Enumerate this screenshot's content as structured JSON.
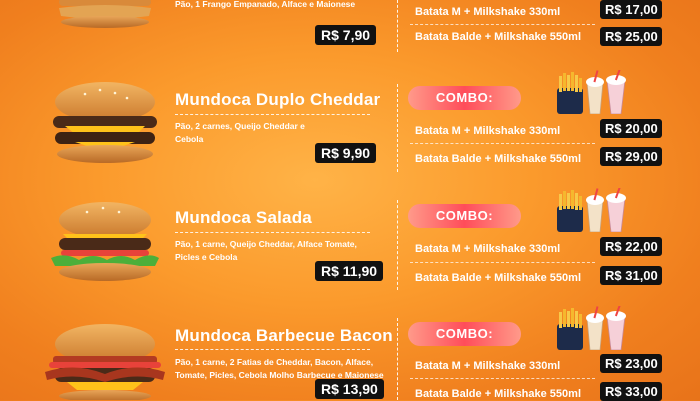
{
  "items": [
    {
      "name": "",
      "desc": "Pão, 1 Frango Empanado, Alface e Maionese",
      "price": "R$ 7,90",
      "combo_label": "",
      "combos": [
        {
          "label": "Batata M + Milkshake 330ml",
          "price": "R$ 17,00"
        },
        {
          "label": "Batata Balde + Milkshake 550ml",
          "price": "R$ 25,00"
        }
      ]
    },
    {
      "name": "Mundoca Duplo Cheddar",
      "desc": "Pão, 2 carnes, Queijo Cheddar e Cebola",
      "price": "R$ 9,90",
      "combo_label": "COMBO:",
      "combos": [
        {
          "label": "Batata M + Milkshake 330ml",
          "price": "R$ 20,00"
        },
        {
          "label": "Batata Balde + Milkshake 550ml",
          "price": "R$ 29,00"
        }
      ]
    },
    {
      "name": "Mundoca Salada",
      "desc": "Pão, 1 carne, Queijo Cheddar, Alface Tomate, Picles e Cebola",
      "price": "R$ 11,90",
      "combo_label": "COMBO:",
      "combos": [
        {
          "label": "Batata M + Milkshake 330ml",
          "price": "R$ 22,00"
        },
        {
          "label": "Batata Balde + Milkshake 550ml",
          "price": "R$ 31,00"
        }
      ]
    },
    {
      "name": "Mundoca Barbecue Bacon",
      "desc": "Pão, 1 carne, 2 Fatias de Cheddar, Bacon, Alface, Tomate, Picles, Cebola Molho Barbecue e Maionese",
      "price": "R$ 13,90",
      "combo_label": "COMBO:",
      "combos": [
        {
          "label": "Batata M + Milkshake 330ml",
          "price": "R$ 23,00"
        },
        {
          "label": "Batata Balde + Milkshake 550ml",
          "price": "R$ 33,00"
        }
      ]
    }
  ],
  "colors": {
    "background": "#fb9a2c",
    "price_tag": "#111111",
    "combo_badge": "#ff4d5a"
  },
  "icons": [
    "burger-image",
    "fries-icon",
    "milkshake-icon"
  ]
}
